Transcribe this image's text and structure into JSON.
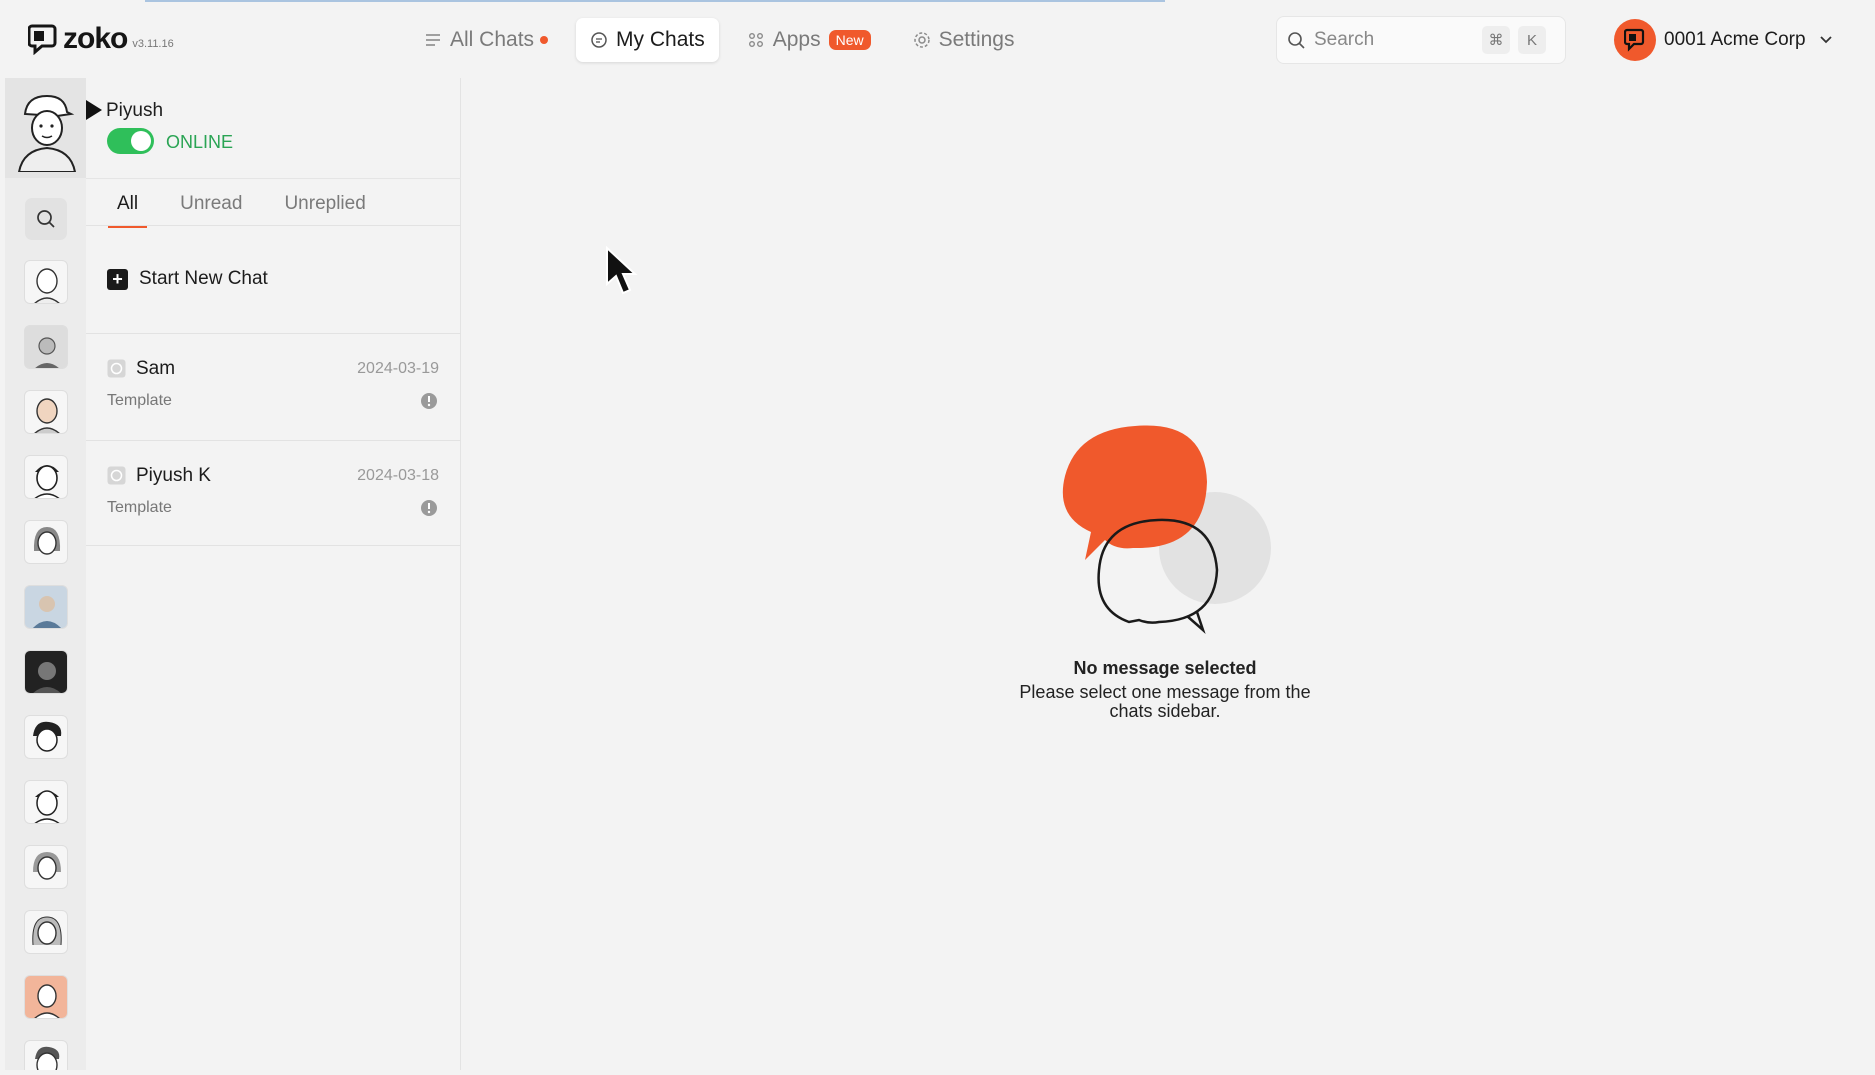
{
  "header": {
    "logo_text": "zoko",
    "version": "v3.11.16",
    "nav": [
      {
        "label": "All Chats",
        "icon": "list-icon",
        "has_dot": true
      },
      {
        "label": "My Chats",
        "icon": "chat-bubble-icon",
        "active": true
      },
      {
        "label": "Apps",
        "icon": "grid-icon",
        "badge": "New"
      },
      {
        "label": "Settings",
        "icon": "gear-icon"
      }
    ],
    "search": {
      "placeholder": "Search",
      "shortcut_mod": "⌘",
      "shortcut_key": "K"
    },
    "account": {
      "name": "0001 Acme Corp"
    }
  },
  "sidebar": {
    "user": {
      "name": "Piyush",
      "status": "ONLINE",
      "online": true
    },
    "tabs": [
      {
        "label": "All",
        "active": true
      },
      {
        "label": "Unread"
      },
      {
        "label": "Unreplied"
      }
    ],
    "new_chat_label": "Start New Chat",
    "chats": [
      {
        "name": "Sam",
        "date": "2024-03-19",
        "preview": "Template"
      },
      {
        "name": "Piyush K",
        "date": "2024-03-18",
        "preview": "Template"
      }
    ]
  },
  "main": {
    "empty_title": "No message selected",
    "empty_desc": "Please select one message from the chats sidebar."
  },
  "colors": {
    "accent": "#f0592c",
    "online": "#2fbf5a",
    "background": "#f3f3f3"
  }
}
